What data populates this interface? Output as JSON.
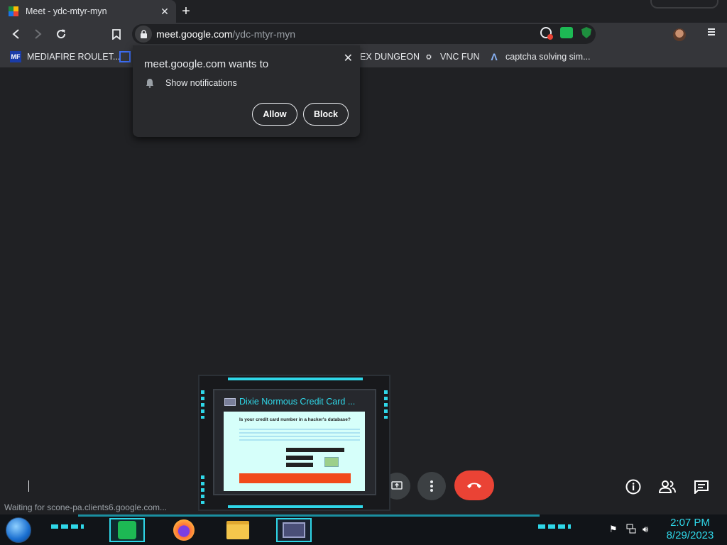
{
  "tab": {
    "title": "Meet - ydc-mtyr-myn",
    "close": "✕"
  },
  "toolbar": {
    "url_host": "meet.google.com",
    "url_path": "/ydc-mtyr-myn"
  },
  "bookmarks": [
    {
      "label": "MEDIAFIRE ROULET...",
      "icon": "mediafire-icon"
    },
    {
      "label": "EX DUNGEON",
      "icon": ""
    },
    {
      "label": "VNC FUN",
      "icon": "vnc-icon"
    },
    {
      "label": "captcha solving sim...",
      "icon": "captcha-icon"
    }
  ],
  "permission": {
    "title": "meet.google.com wants to",
    "item": "Show notifications",
    "allow": "Allow",
    "block": "Block"
  },
  "status_bar": "Waiting for scone-pa.clients6.google.com...",
  "thumbnail": {
    "title": "Dixie Normous Credit Card ...",
    "page_heading": "Is your credit card number in a hacker's database?"
  },
  "taskbar": {
    "time": "2:07 PM",
    "date": "8/29/2023"
  },
  "colors": {
    "accent_cyan": "#2fd7e8",
    "hangup_red": "#ea4335",
    "chrome_dark": "#202124",
    "chrome_toolbar": "#35363a"
  }
}
